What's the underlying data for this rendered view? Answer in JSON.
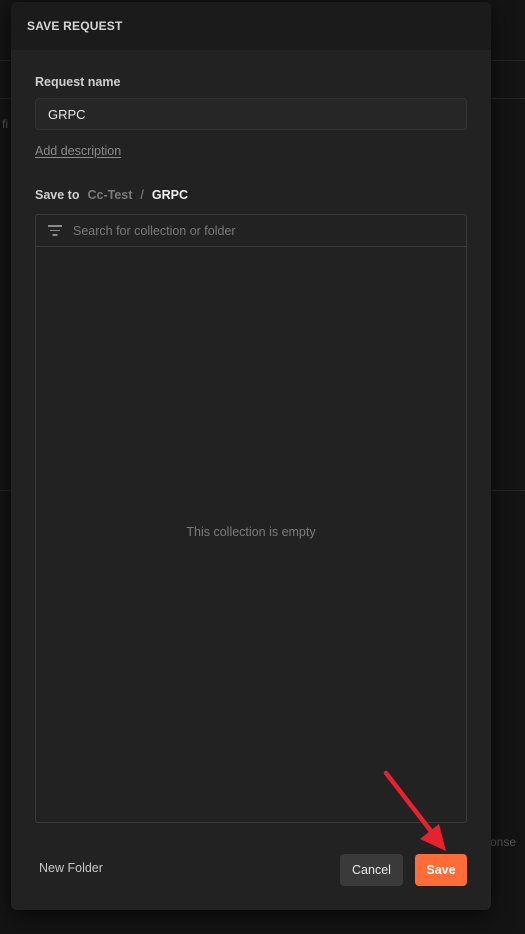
{
  "background": {
    "left_fragment": "fi",
    "right_fragment": "onse"
  },
  "modal": {
    "title": "SAVE REQUEST",
    "request_name_label": "Request name",
    "request_name_value": "GRPC",
    "add_description": "Add description",
    "save_to": {
      "label": "Save to",
      "breadcrumb": [
        "Cc-Test",
        "/",
        "GRPC"
      ]
    },
    "search_placeholder": "Search for collection or folder",
    "empty_message": "This collection is empty",
    "footer": {
      "new_folder": "New Folder",
      "cancel": "Cancel",
      "save": "Save"
    }
  },
  "colors": {
    "accent": "#ff6c37",
    "annotation_arrow": "#e8212e"
  },
  "icons": [
    "filter-icon",
    "annotation-arrow"
  ]
}
